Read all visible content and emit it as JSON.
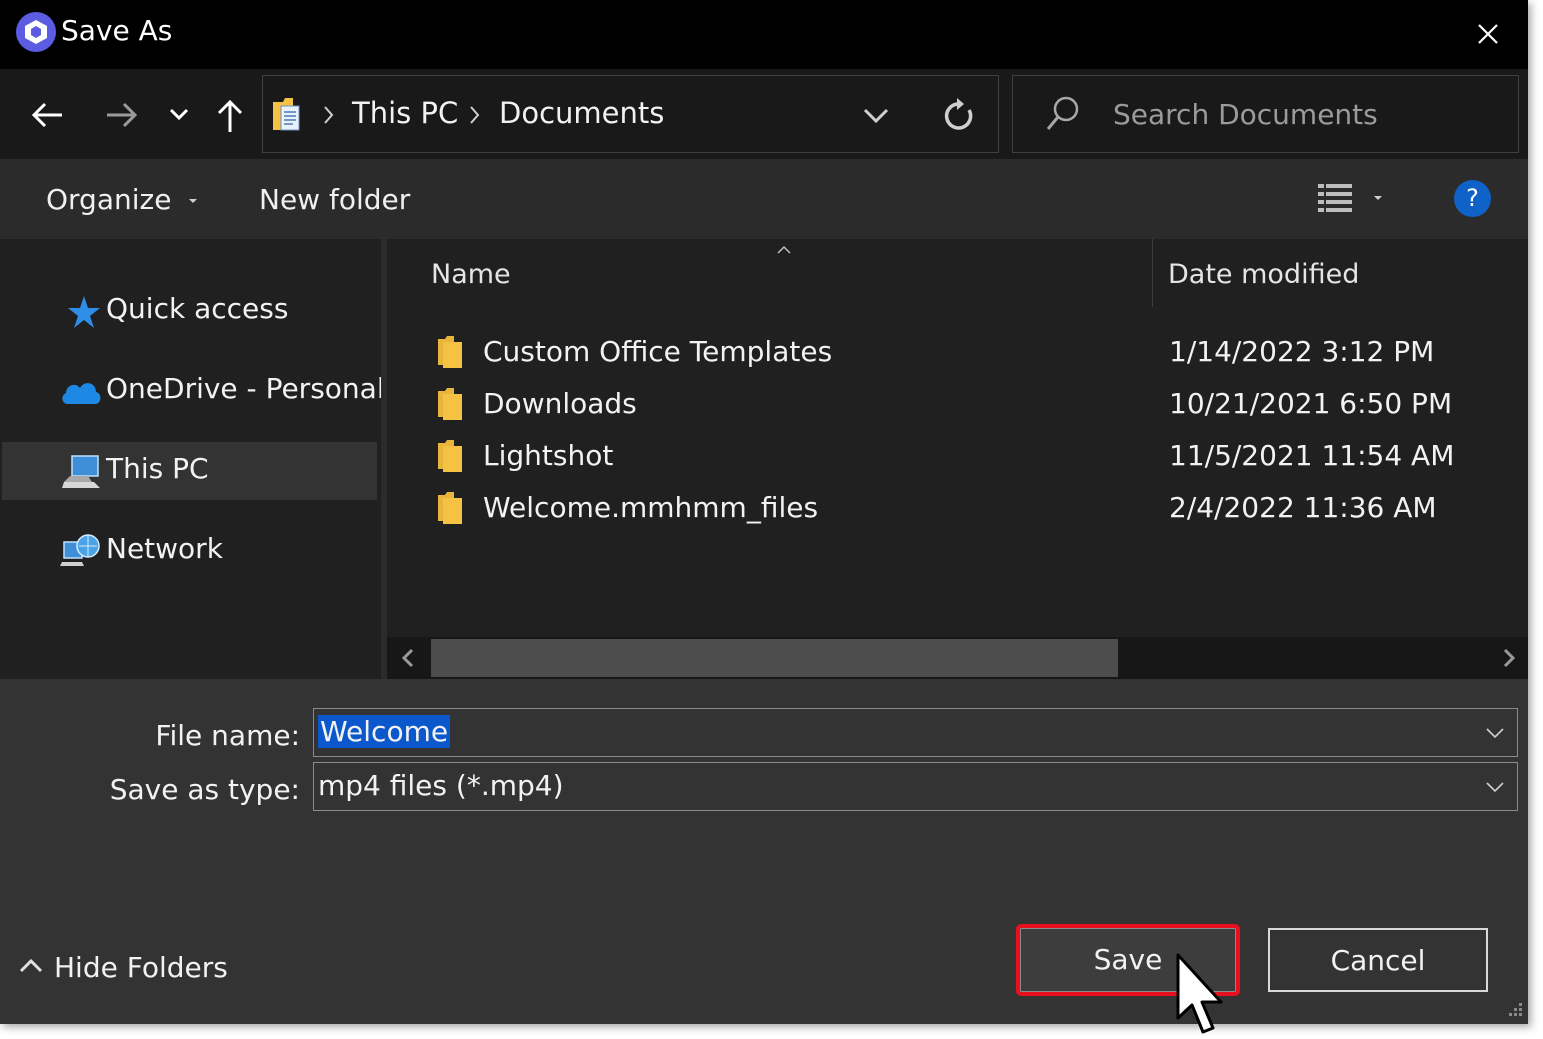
{
  "window": {
    "title": "Save As"
  },
  "address_bar": {
    "crumbs": [
      "This PC",
      "Documents"
    ]
  },
  "search": {
    "placeholder": "Search Documents"
  },
  "toolbar": {
    "organize_label": "Organize",
    "new_folder_label": "New folder",
    "help_label": "?"
  },
  "sidebar": {
    "items": [
      {
        "label": "Quick access",
        "icon": "star-icon"
      },
      {
        "label": "OneDrive - Personal",
        "icon": "cloud-icon"
      },
      {
        "label": "This PC",
        "icon": "computer-icon",
        "selected": true
      },
      {
        "label": "Network",
        "icon": "network-icon"
      }
    ]
  },
  "file_list": {
    "columns": [
      "Name",
      "Date modified"
    ],
    "rows": [
      {
        "name": "Custom Office Templates",
        "date": "1/14/2022 3:12 PM"
      },
      {
        "name": "Downloads",
        "date": "10/21/2021 6:50 PM"
      },
      {
        "name": "Lightshot",
        "date": "11/5/2021 11:54 AM"
      },
      {
        "name": "Welcome.mmhmm_files",
        "date": "2/4/2022 11:36 AM"
      }
    ]
  },
  "form": {
    "file_name_label": "File name:",
    "file_name_value": "Welcome",
    "save_type_label": "Save as type:",
    "save_type_value": "mp4 files (*.mp4)"
  },
  "footer": {
    "hide_folders_label": "Hide Folders",
    "save_label": "Save",
    "cancel_label": "Cancel"
  },
  "colors": {
    "accent_blue": "#0b58cc",
    "highlight_red": "#e8101e",
    "folder_yellow": "#f6c244"
  }
}
